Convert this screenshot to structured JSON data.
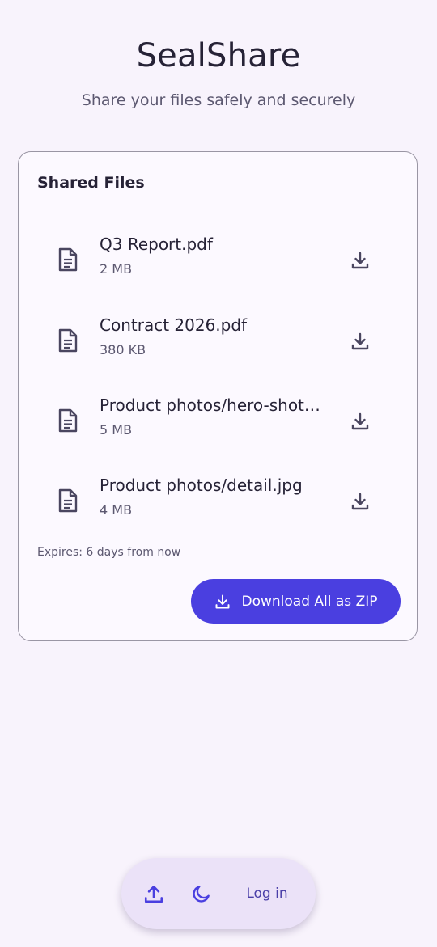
{
  "header": {
    "title": "SealShare",
    "subtitle": "Share your files safely and securely"
  },
  "card": {
    "title": "Shared Files",
    "files": [
      {
        "name": "Q3 Report.pdf",
        "size": "2 MB"
      },
      {
        "name": "Contract 2026.pdf",
        "size": "380 KB"
      },
      {
        "name": "Product photos/hero-shot.jpg",
        "size": "5 MB"
      },
      {
        "name": "Product photos/detail.jpg",
        "size": "4 MB"
      }
    ],
    "expires": "Expires: 6 days from now",
    "zip_button_label": "Download All as ZIP"
  },
  "bottom_bar": {
    "upload_icon": "upload-icon",
    "theme_icon": "moon-icon",
    "login_label": "Log in"
  },
  "colors": {
    "background": "#f8f3fc",
    "accent": "#4a3fe0",
    "text_primary": "#262236",
    "text_secondary": "#5c5870",
    "icon": "#4a4660"
  }
}
